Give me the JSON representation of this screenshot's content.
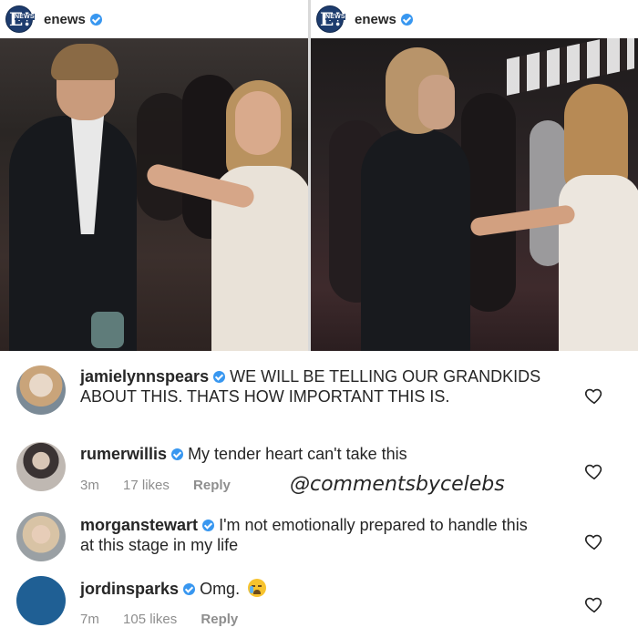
{
  "posts": [
    {
      "username": "enews",
      "logo_text": "E!",
      "logo_sub": "NEWS"
    },
    {
      "username": "enews",
      "logo_text": "E!",
      "logo_sub": "NEWS"
    }
  ],
  "comments": [
    {
      "username": "jamielynnspears",
      "text": "WE WILL BE TELLING OUR GRANDKIDS ABOUT THIS. THATS HOW IMPORTANT THIS IS."
    },
    {
      "username": "rumerwillis",
      "text": "My tender heart can't take this",
      "time": "3m",
      "likes": "17 likes",
      "reply": "Reply"
    },
    {
      "username": "morganstewart",
      "text": "I'm not emotionally prepared to handle this at this stage in my life"
    },
    {
      "username": "jordinsparks",
      "text": "Omg.",
      "time": "7m",
      "likes": "105 likes",
      "reply": "Reply"
    }
  ],
  "watermark": "@commentsbycelebs",
  "icons": {
    "verified": "verified-badge-icon",
    "heart": "heart-outline-icon",
    "emoji": "crying-face-emoji-icon"
  },
  "colors": {
    "verified": "#3897f0",
    "meta_text": "#8e8e8e",
    "text": "#262626",
    "jordin_avatar": "#1f5f94",
    "enews_logo": "#1d3c6e"
  }
}
